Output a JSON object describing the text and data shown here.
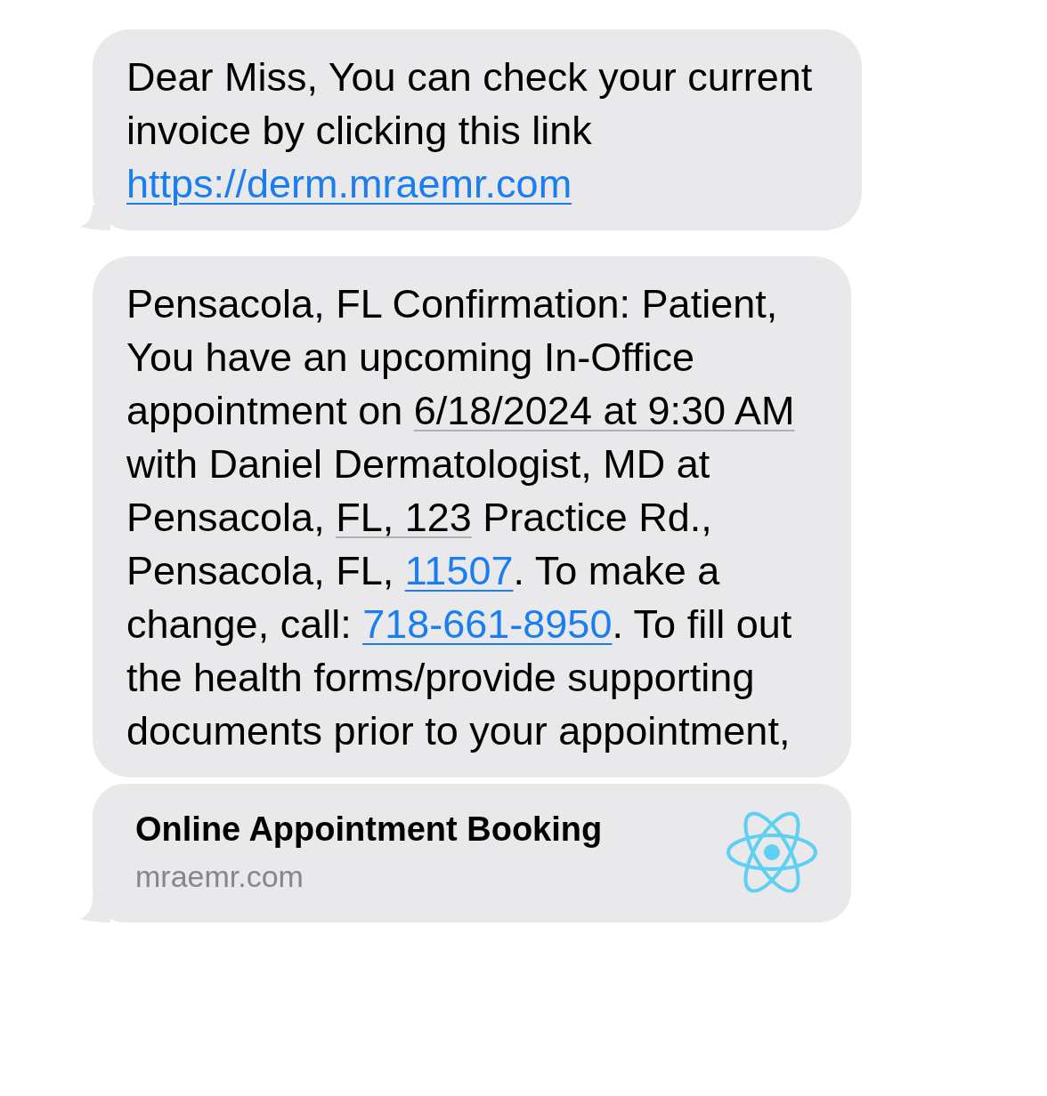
{
  "messages": [
    {
      "segments": [
        {
          "kind": "plain",
          "text": "Dear Miss, You can check your current invoice by clicking this link "
        },
        {
          "kind": "link",
          "text": "https://derm.mraemr.com"
        }
      ]
    },
    {
      "segments": [
        {
          "kind": "plain",
          "text": "Pensacola, FL Confirmation: Patient, You have an upcoming In-Office appointment on "
        },
        {
          "kind": "detected",
          "text": "6/18/2024 at 9:30 AM"
        },
        {
          "kind": "plain",
          "text": " with Daniel Dermatologist, MD at Pensacola, "
        },
        {
          "kind": "detected",
          "text": "FL, 123"
        },
        {
          "kind": "plain",
          "text": " Practice Rd., Pensacola, FL, "
        },
        {
          "kind": "link",
          "text": "11507"
        },
        {
          "kind": "plain",
          "text": ". To make a change, call: "
        },
        {
          "kind": "link",
          "text": "718-661-8950"
        },
        {
          "kind": "plain",
          "text": ". To fill out the health forms/provide supporting documents prior to your appointment,"
        }
      ]
    }
  ],
  "link_preview": {
    "title": "Online Appointment Booking",
    "domain": "mraemr.com"
  }
}
